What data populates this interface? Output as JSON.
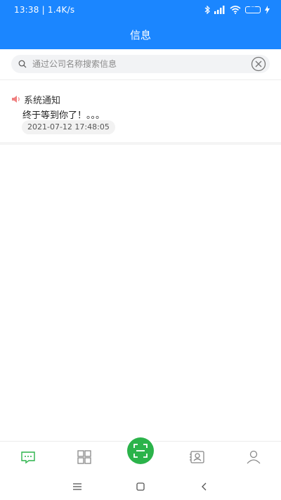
{
  "status_bar": {
    "time_speed": "13:38 | 1.4K/s",
    "battery_level": "85",
    "battery_fraction": 0.85,
    "icons": [
      "bluetooth-icon",
      "signal-icon",
      "wifi-icon",
      "battery-icon",
      "charging-icon"
    ]
  },
  "header": {
    "title": "信息",
    "background_color": "#1b86ff"
  },
  "search": {
    "placeholder": "通过公司名称搜索信息",
    "value": ""
  },
  "notices": [
    {
      "icon": "speaker-icon",
      "title": "系统通知",
      "body": "终于等到你了！。。。",
      "time": "2021-07-12 17:48:05"
    }
  ],
  "bottom_nav": {
    "items": [
      "message-icon",
      "grid-icon",
      "scan-icon",
      "contact-card-icon",
      "user-icon"
    ],
    "active": "message-icon",
    "active_color": "#2bb34a",
    "scan_color": "#2bb34a"
  },
  "system_nav": {
    "items": [
      "menu-icon",
      "home-icon",
      "back-icon"
    ]
  }
}
